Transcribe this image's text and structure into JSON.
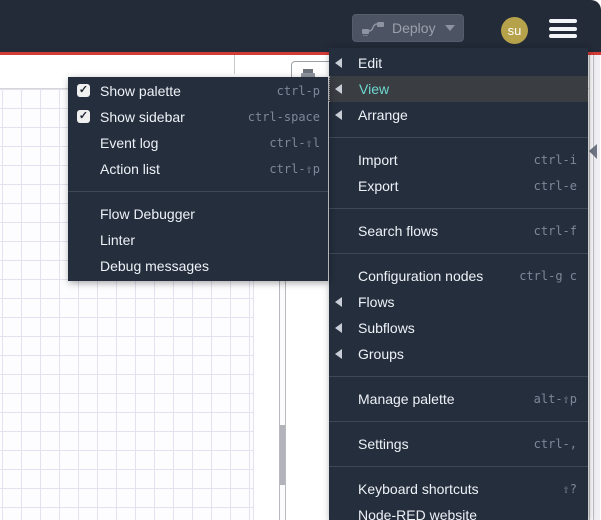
{
  "header": {
    "deploy_label": "Deploy",
    "user_initials": "su"
  },
  "icons": {
    "check": "✓",
    "deploy_icon": "node-wire",
    "hamburger_icon": "three-bars",
    "deploy_caret_icon": "chevron-down"
  },
  "colors": {
    "header_bg": "#232a38",
    "accent_red": "#d23b36",
    "menu_bg": "#242e3d",
    "menu_active_bg": "#3a3d42",
    "menu_active_text": "#6ed7d0",
    "menu_text": "#eef2f7",
    "shortcut_text": "#7e8799",
    "avatar_bg": "#b5a24b",
    "deploy_button_bg": "#4c5464",
    "canvas_grid_line": "#e4e1f0"
  },
  "main_menu": {
    "groups": [
      {
        "items": [
          {
            "label": "Edit",
            "has_submenu": true
          },
          {
            "label": "View",
            "has_submenu": true,
            "active": true
          },
          {
            "label": "Arrange",
            "has_submenu": true
          }
        ]
      },
      {
        "items": [
          {
            "label": "Import",
            "shortcut": "ctrl-i"
          },
          {
            "label": "Export",
            "shortcut": "ctrl-e"
          }
        ]
      },
      {
        "items": [
          {
            "label": "Search flows",
            "shortcut": "ctrl-f"
          }
        ]
      },
      {
        "items": [
          {
            "label": "Configuration nodes",
            "shortcut": "ctrl-g c"
          },
          {
            "label": "Flows",
            "has_submenu": true
          },
          {
            "label": "Subflows",
            "has_submenu": true
          },
          {
            "label": "Groups",
            "has_submenu": true
          }
        ]
      },
      {
        "items": [
          {
            "label": "Manage palette",
            "shortcut": "alt-⇧p"
          }
        ]
      },
      {
        "items": [
          {
            "label": "Settings",
            "shortcut": "ctrl-,"
          }
        ]
      },
      {
        "items": [
          {
            "label": "Keyboard shortcuts",
            "shortcut": "⇧?"
          },
          {
            "label": "Node-RED website"
          }
        ]
      }
    ]
  },
  "view_submenu": {
    "groups": [
      {
        "items": [
          {
            "label": "Show palette",
            "shortcut": "ctrl-p",
            "checked": true
          },
          {
            "label": "Show sidebar",
            "shortcut": "ctrl-space",
            "checked": true
          },
          {
            "label": "Event log",
            "shortcut": "ctrl-⇧l"
          },
          {
            "label": "Action list",
            "shortcut": "ctrl-⇧p"
          }
        ]
      },
      {
        "items": [
          {
            "label": "Flow Debugger"
          },
          {
            "label": "Linter"
          },
          {
            "label": "Debug messages"
          }
        ]
      }
    ]
  }
}
